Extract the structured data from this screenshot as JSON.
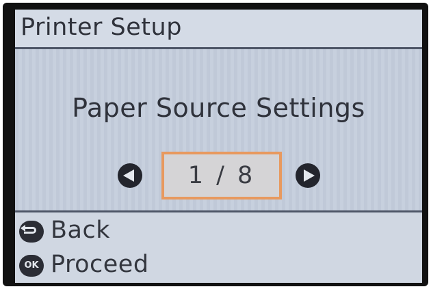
{
  "header": {
    "title": "Printer Setup"
  },
  "main": {
    "title": "Paper Source Settings",
    "pager": {
      "text": "1 / 8",
      "current": 1,
      "total": 8,
      "prev_icon": "left-arrow-icon",
      "next_icon": "right-arrow-icon"
    }
  },
  "footer": {
    "back_label": "Back",
    "back_icon": "back-return-icon",
    "proceed_label": "Proceed",
    "proceed_icon": "ok-button-icon",
    "ok_glyph": "OK"
  },
  "colors": {
    "screen_background": "#c5cedd",
    "text": "#2f323b",
    "highlight_border": "#e8995e",
    "icon": "#23252d"
  }
}
